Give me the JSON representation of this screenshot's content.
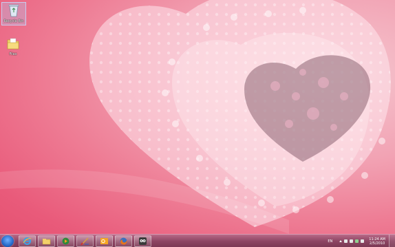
{
  "desktop": {
    "icons": [
      {
        "label": "Recycle Bin",
        "icon": "recycle-bin-icon"
      },
      {
        "label": "Files",
        "icon": "folder-icon"
      }
    ]
  },
  "taskbar": {
    "start_icon": "windows-start-icon",
    "pinned": [
      {
        "icon": "internet-explorer-icon"
      },
      {
        "icon": "windows-explorer-icon"
      },
      {
        "icon": "media-player-icon"
      },
      {
        "icon": "paint-icon"
      },
      {
        "icon": "outlook-icon"
      },
      {
        "icon": "firefox-icon"
      },
      {
        "icon": "owl-app-icon"
      }
    ],
    "tray": {
      "language": "EN",
      "time": "11:24 AM",
      "date": "2/5/2010"
    }
  },
  "colors": {
    "wallpaper_pink": "#ee7d95",
    "taskbar": "#8d4563"
  }
}
